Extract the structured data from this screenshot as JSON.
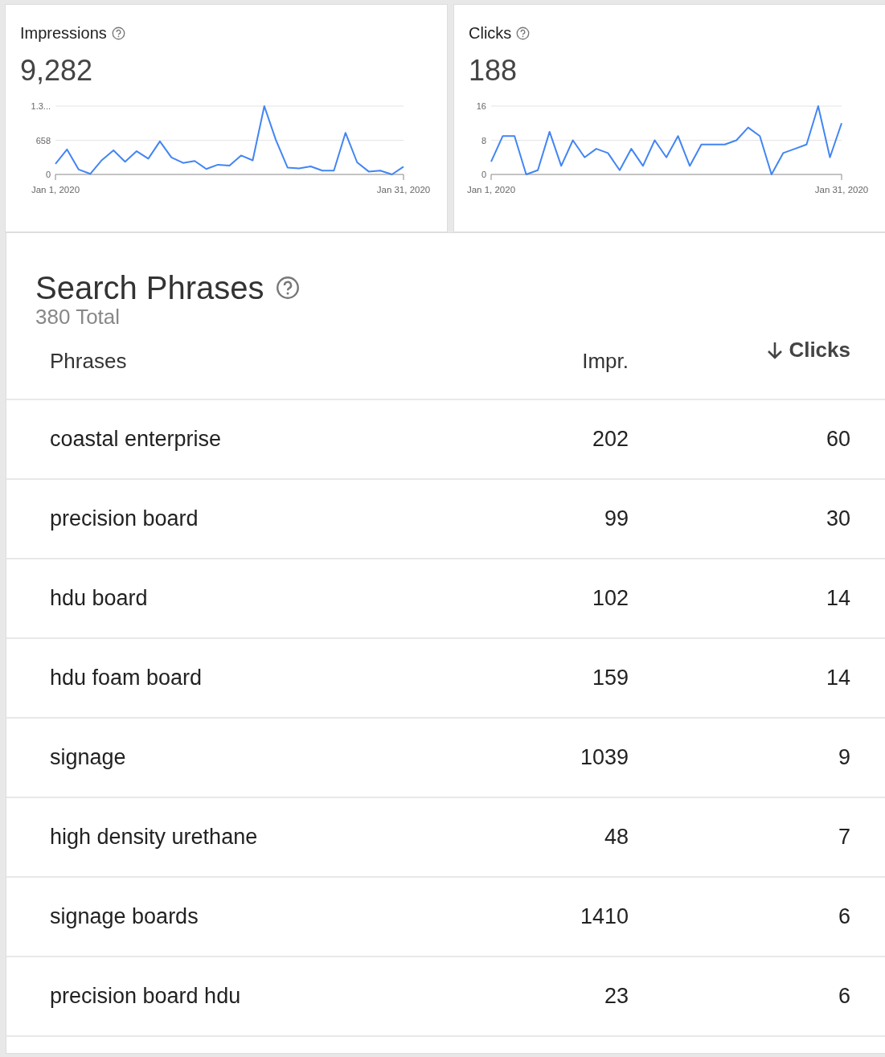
{
  "metrics": [
    {
      "title": "Impressions",
      "value": "9,282",
      "chart_data": {
        "type": "line",
        "categories": [
          "Jan 1, 2020",
          null,
          null,
          null,
          null,
          null,
          null,
          null,
          null,
          null,
          null,
          null,
          null,
          null,
          null,
          null,
          null,
          null,
          null,
          null,
          null,
          null,
          null,
          null,
          null,
          null,
          null,
          null,
          null,
          null,
          "Jan 31, 2020"
        ],
        "series": [
          {
            "color": "#4285f4",
            "values": [
              205,
              481,
              94,
              11,
              276,
              464,
              243,
              448,
              304,
              636,
              326,
              221,
              260,
              105,
              188,
              171,
              365,
              271,
              1316,
              664,
              133,
              116,
              155,
              72,
              72,
              802,
              232,
              55,
              72,
              0,
              149
            ]
          }
        ],
        "ylim": [
          0,
          1316
        ],
        "yticks": [
          0,
          658,
          {
            "value": 1316,
            "label": "1.3..."
          }
        ]
      }
    },
    {
      "title": "Clicks",
      "value": "188",
      "chart_data": {
        "type": "line",
        "categories": [
          "Jan 1, 2020",
          null,
          null,
          null,
          null,
          null,
          null,
          null,
          null,
          null,
          null,
          null,
          null,
          null,
          null,
          null,
          null,
          null,
          null,
          null,
          null,
          null,
          null,
          null,
          null,
          null,
          null,
          null,
          null,
          null,
          "Jan 31, 2020"
        ],
        "series": [
          {
            "color": "#4285f4",
            "values": [
              3,
              9,
              9,
              0,
              1,
              10,
              2,
              8,
              4,
              6,
              5,
              1,
              6,
              2,
              8,
              4,
              9,
              2,
              7,
              7,
              7,
              8,
              11,
              9,
              0,
              5,
              6,
              7,
              16,
              4,
              12
            ]
          }
        ],
        "ylim": [
          0,
          16
        ],
        "yticks": [
          0,
          8,
          16
        ]
      }
    }
  ],
  "phrases": {
    "title": "Search Phrases",
    "total": "380 Total",
    "columns": [
      {
        "label": "Phrases",
        "sorted": false
      },
      {
        "label": "Impr.",
        "sorted": false
      },
      {
        "label": "Clicks",
        "sorted": true
      }
    ],
    "rows": [
      [
        "coastal enterprise",
        "202",
        "60"
      ],
      [
        "precision board",
        "99",
        "30"
      ],
      [
        "hdu board",
        "102",
        "14"
      ],
      [
        "hdu foam board",
        "159",
        "14"
      ],
      [
        "signage",
        "1039",
        "9"
      ],
      [
        "high density urethane",
        "48",
        "7"
      ],
      [
        "signage boards",
        "1410",
        "6"
      ],
      [
        "precision board hdu",
        "23",
        "6"
      ]
    ]
  }
}
